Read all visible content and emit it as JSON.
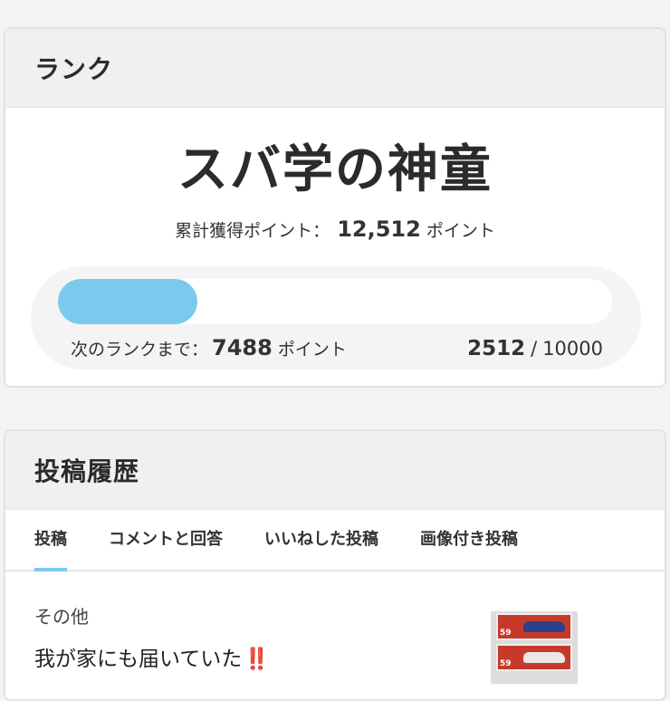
{
  "rank_card": {
    "header": "ランク",
    "rank_name": "スバ学の神童",
    "total_label": "累計獲得ポイント：",
    "total_value": "12,512",
    "total_unit": "ポイント",
    "progress": {
      "fraction": 0.2512,
      "fill_color": "#7cc9ee",
      "next_label": "次のランクまで：",
      "next_value": "7488",
      "next_unit": "ポイント",
      "current": "2512",
      "separator": "/",
      "max": "10000"
    }
  },
  "history_card": {
    "header": "投稿履歴",
    "tabs": [
      {
        "label": "投稿",
        "active": true
      },
      {
        "label": "コメントと回答",
        "active": false
      },
      {
        "label": "いいねした投稿",
        "active": false
      },
      {
        "label": "画像付き投稿",
        "active": false
      }
    ],
    "post": {
      "category": "その他",
      "title": "我が家にも届いていた",
      "emoji": "‼️",
      "thumbnail_icon": "toy-car-box-image",
      "box_number": "59"
    }
  }
}
